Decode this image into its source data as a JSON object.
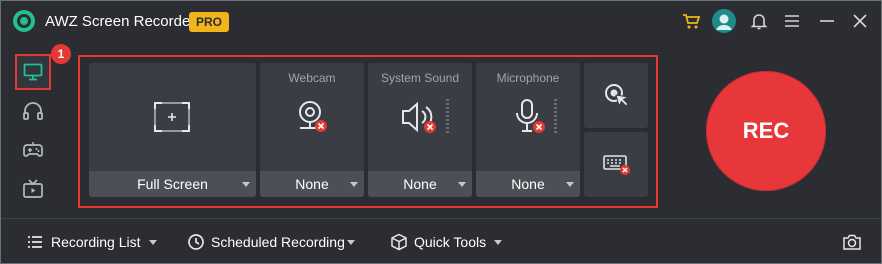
{
  "app": {
    "title": "AWZ Screen Recorder",
    "badge": "PRO",
    "accent_color": "#e53935",
    "rec_color": "#e8373a"
  },
  "titlebar": {
    "icons": [
      "cart-icon",
      "user-avatar-icon",
      "bell-icon",
      "menu-icon",
      "minimize-icon",
      "close-icon"
    ]
  },
  "sidebar": {
    "items": [
      {
        "name": "screen-recording",
        "icon": "monitor-icon",
        "active": true
      },
      {
        "name": "audio-recording",
        "icon": "headphones-icon",
        "active": false
      },
      {
        "name": "game-recording",
        "icon": "gamepad-icon",
        "active": false
      },
      {
        "name": "tv-recording",
        "icon": "tv-icon",
        "active": false
      }
    ],
    "step_badge": "1"
  },
  "sources": {
    "screen": {
      "value": "Full Screen",
      "icon": "screen-select-icon"
    },
    "webcam": {
      "label": "Webcam",
      "value": "None",
      "icon": "webcam-icon"
    },
    "system_sound": {
      "label": "System Sound",
      "value": "None",
      "icon": "speaker-icon"
    },
    "microphone": {
      "label": "Microphone",
      "value": "None",
      "icon": "microphone-icon"
    },
    "side_buttons": [
      "mouse-click-effect-icon",
      "keyboard-display-icon"
    ]
  },
  "rec_button": {
    "label": "REC"
  },
  "bottom_bar": {
    "recording_list": "Recording List",
    "scheduled_recording": "Scheduled Recording",
    "quick_tools": "Quick Tools",
    "screenshot_icon": "camera-icon"
  }
}
